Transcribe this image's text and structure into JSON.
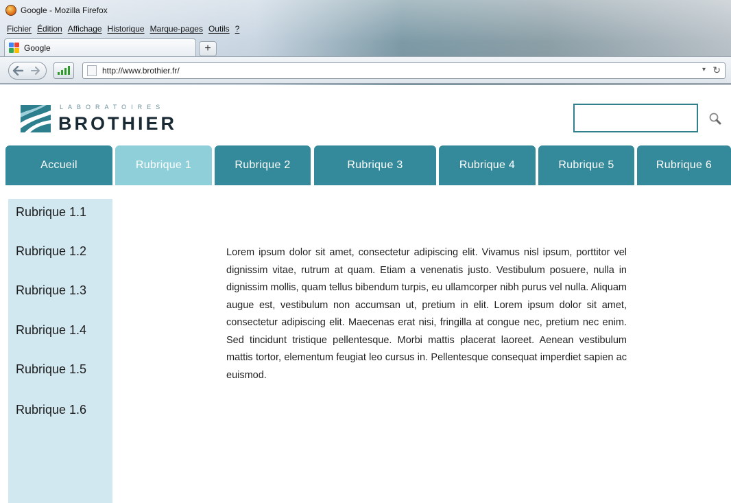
{
  "browser": {
    "window_title": "Google - Mozilla Firefox",
    "menu": [
      "Fichier",
      "Édition",
      "Affichage",
      "Historique",
      "Marque-pages",
      "Outils",
      "?"
    ],
    "tab": {
      "title": "Google"
    },
    "new_tab_symbol": "+",
    "address": "http://www.brothier.fr/",
    "address_dropdown_symbol": "▾",
    "reload_symbol": "↻"
  },
  "site": {
    "logo": {
      "small_text": "LABORATOIRES",
      "name": "BROTHIER"
    },
    "search": {
      "value": "",
      "placeholder": ""
    },
    "nav": [
      {
        "label": "Accueil",
        "active": false
      },
      {
        "label": "Rubrique 1",
        "active": true
      },
      {
        "label": "Rubrique 2",
        "active": false
      },
      {
        "label": "Rubrique 3",
        "active": false
      },
      {
        "label": "Rubrique 4",
        "active": false
      },
      {
        "label": "Rubrique 5",
        "active": false
      },
      {
        "label": "Rubrique 6",
        "active": false
      }
    ],
    "sidebar": [
      "Rubrique 1.1",
      "Rubrique 1.2",
      "Rubrique 1.3",
      "Rubrique 1.4",
      "Rubrique 1.5",
      "Rubrique 1.6"
    ],
    "body_text": "Lorem ipsum dolor sit amet, consectetur adipiscing elit. Vivamus nisl ipsum, porttitor vel dignissim vitae, rutrum at quam. Etiam a venenatis justo. Vestibulum posuere, nulla in dignissim mollis, quam tellus bibendum turpis, eu ullamcorper nibh purus vel nulla. Aliquam augue est, vestibulum non accumsan ut, pretium in elit. Lorem ipsum dolor sit amet, consectetur adipiscing elit. Maecenas erat nisi, fringilla at congue nec, pretium nec enim. Sed tincidunt tristique pellentesque. Morbi mattis placerat laoreet. Aenean vestibulum mattis tortor, elementum feugiat leo cursus in. Pellentesque consequat imperdiet sapien ac euismod."
  },
  "colors": {
    "nav": "#34899a",
    "nav_active": "#8fcfd9",
    "sidebar": "#d2e8f1",
    "search_border": "#2f7f8c"
  },
  "icons": {
    "browser": "firefox-logo-icon",
    "tab": "google-favicon-icon",
    "site_logo": "brothier-logo-icon",
    "search": "magnifier-icon"
  }
}
